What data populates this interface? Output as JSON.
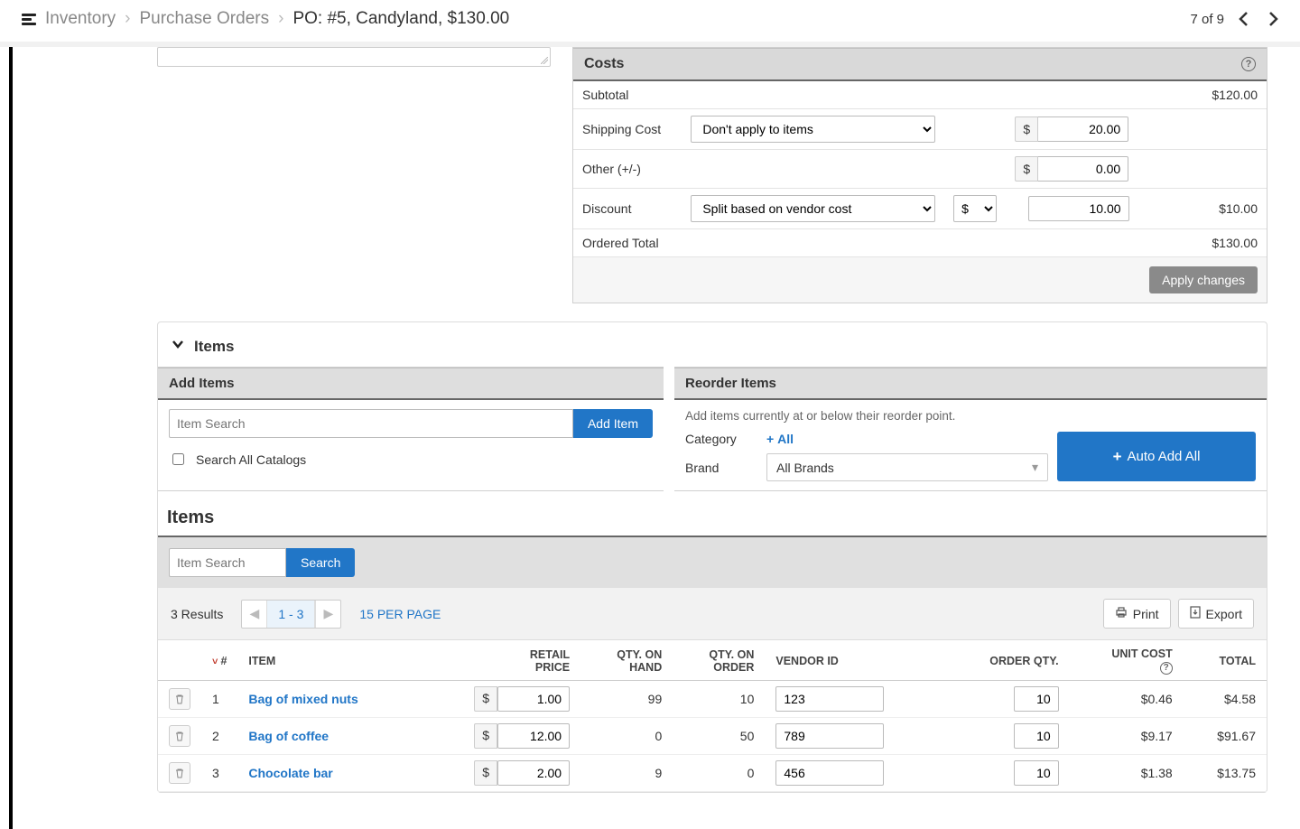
{
  "breadcrumb": {
    "level1": "Inventory",
    "level2": "Purchase Orders",
    "current": "PO:  #5, Candyland, $130.00"
  },
  "paginator": {
    "text": "7 of 9"
  },
  "costs": {
    "title": "Costs",
    "rows": {
      "subtotal_label": "Subtotal",
      "subtotal_amount": "$120.00",
      "shipping_label": "Shipping Cost",
      "shipping_select": "Don't apply to items",
      "shipping_currency": "$",
      "shipping_value": "20.00",
      "other_label": "Other (+/-)",
      "other_currency": "$",
      "other_value": "0.00",
      "discount_label": "Discount",
      "discount_select": "Split based on vendor cost",
      "discount_currency": "$",
      "discount_input": "10.00",
      "discount_amount": "$10.00",
      "total_label": "Ordered Total",
      "total_amount": "$130.00"
    },
    "apply_button": "Apply changes"
  },
  "items_section": {
    "title": "Items",
    "add_panel": {
      "title": "Add Items",
      "placeholder": "Item Search",
      "button": "Add Item",
      "checkbox": "Search All Catalogs"
    },
    "reorder_panel": {
      "title": "Reorder Items",
      "desc": "Add items currently at or below their reorder point.",
      "category_label": "Category",
      "all_link": "All",
      "brand_label": "Brand",
      "brand_value": "All Brands",
      "auto_button": "Auto Add All"
    }
  },
  "items_list": {
    "heading": "Items",
    "search_placeholder": "Item Search",
    "search_button": "Search",
    "results_text": "3 Results",
    "page_range": "1 - 3",
    "per_page": "15 PER PAGE",
    "print": "Print",
    "export": "Export",
    "columns": {
      "num": "#",
      "item": "ITEM",
      "retail1": "RETAIL",
      "retail2": "PRICE",
      "qtyhand1": "QTY. ON",
      "qtyhand2": "HAND",
      "qtyorder1": "QTY. ON",
      "qtyorder2": "ORDER",
      "vendor": "VENDOR ID",
      "orderqty": "ORDER QTY.",
      "unitcost1": "UNIT COST",
      "total": "TOTAL"
    },
    "rows": [
      {
        "num": "1",
        "item": "Bag of mixed nuts",
        "retail": "1.00",
        "onhand": "99",
        "onorder": "10",
        "vendor": "123",
        "orderqty": "10",
        "unitcost": "$0.46",
        "total": "$4.58"
      },
      {
        "num": "2",
        "item": "Bag of coffee",
        "retail": "12.00",
        "onhand": "0",
        "onorder": "50",
        "vendor": "789",
        "orderqty": "10",
        "unitcost": "$9.17",
        "total": "$91.67"
      },
      {
        "num": "3",
        "item": "Chocolate bar",
        "retail": "2.00",
        "onhand": "9",
        "onorder": "0",
        "vendor": "456",
        "orderqty": "10",
        "unitcost": "$1.38",
        "total": "$13.75"
      }
    ]
  }
}
